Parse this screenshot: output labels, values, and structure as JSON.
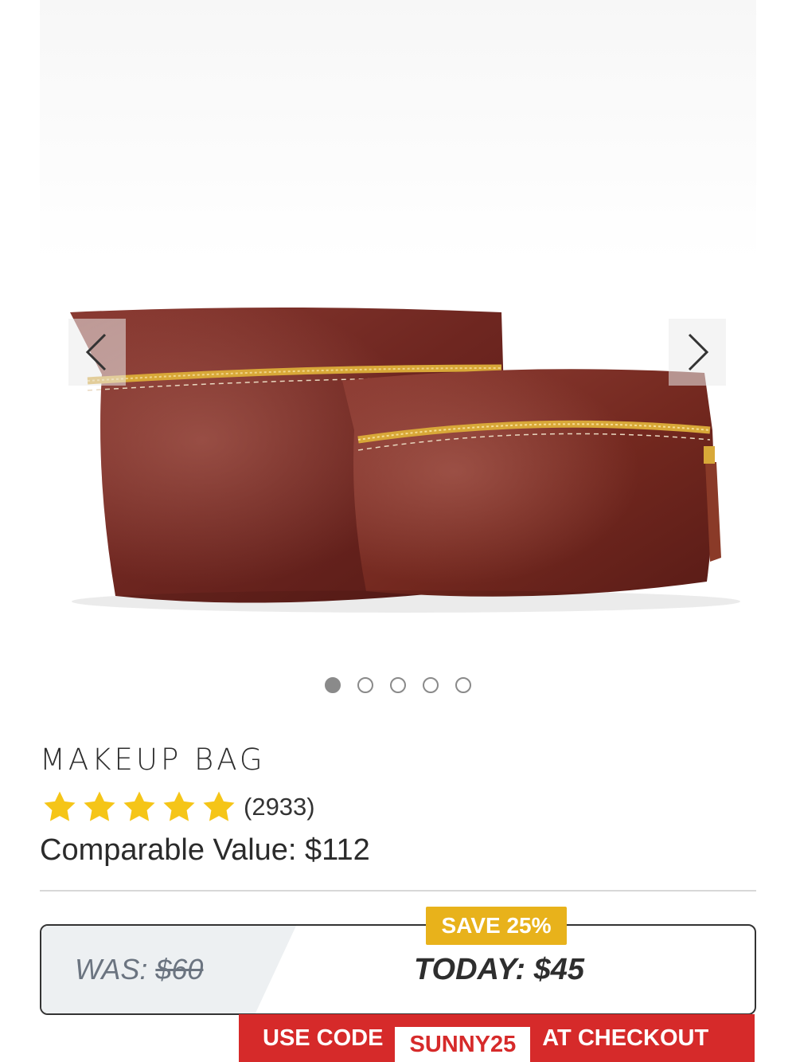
{
  "product": {
    "title": "MAKEUP BAG",
    "rating_stars": 5,
    "rating_count": "(2933)",
    "comparable_value": "Comparable Value: $112"
  },
  "gallery": {
    "image_count": 5,
    "active_index": 0,
    "prev_icon": "chevron-left-icon",
    "next_icon": "chevron-right-icon"
  },
  "pricing": {
    "was_label": "WAS: ",
    "was_price": "$60",
    "today": "TODAY: $45",
    "save_badge": "SAVE 25%"
  },
  "promo": {
    "prefix": "USE CODE",
    "code": "SUNNY25",
    "suffix": "AT CHECKOUT"
  },
  "colors": {
    "leather": "#7a2a24",
    "zipper": "#d8a838",
    "save_badge": "#e8b21b",
    "promo_red": "#d62a2a",
    "star": "#f5c518"
  }
}
